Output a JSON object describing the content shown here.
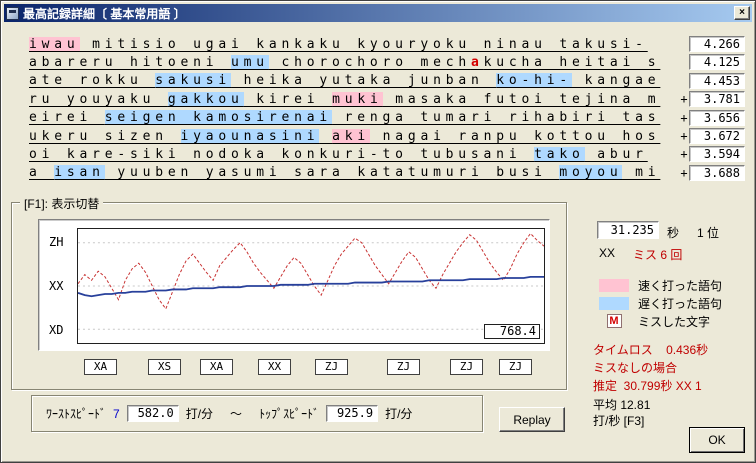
{
  "colors": {
    "fast": "#FFC3D2",
    "slow": "#AFD9FF",
    "miss": "#D40000",
    "red": "#C00000",
    "blue": "#0000CC",
    "title1": "#0A246A",
    "title2": "#A6CAF0"
  },
  "window": {
    "title": "最高記録詳細〔 基本常用語 〕",
    "close_glyph": "×"
  },
  "lines": [
    {
      "plus": false,
      "value": "4.266",
      "segments": [
        {
          "t": "iwau",
          "h": "fast"
        },
        {
          "t": " mitisio ugai kankaku kyouryoku ninau takusi-",
          "h": "none"
        }
      ]
    },
    {
      "plus": false,
      "value": "4.125",
      "segments": [
        {
          "t": "abareru hitoeni ",
          "h": "none"
        },
        {
          "t": "umu",
          "h": "slow"
        },
        {
          "t": " chorochoro mech",
          "h": "none"
        },
        {
          "t": "a",
          "h": "miss"
        },
        {
          "t": "kucha heitai s",
          "h": "none"
        }
      ]
    },
    {
      "plus": false,
      "value": "4.453",
      "segments": [
        {
          "t": "ate rokku ",
          "h": "none"
        },
        {
          "t": "sakusi",
          "h": "slow"
        },
        {
          "t": " heika yutaka junban ",
          "h": "none"
        },
        {
          "t": "ko-hi-",
          "h": "slow"
        },
        {
          "t": " kangae",
          "h": "none"
        }
      ]
    },
    {
      "plus": true,
      "value": "3.781",
      "segments": [
        {
          "t": "ru youyaku ",
          "h": "none"
        },
        {
          "t": "gakkou",
          "h": "slow"
        },
        {
          "t": " kirei ",
          "h": "none"
        },
        {
          "t": "muki",
          "h": "fast"
        },
        {
          "t": " masaka futoi tejina m",
          "h": "none"
        }
      ]
    },
    {
      "plus": true,
      "value": "3.656",
      "segments": [
        {
          "t": "eirei ",
          "h": "none"
        },
        {
          "t": "seigen kamosirenai",
          "h": "slow"
        },
        {
          "t": " renga tumari rihabiri tas",
          "h": "none"
        }
      ]
    },
    {
      "plus": true,
      "value": "3.672",
      "segments": [
        {
          "t": "ukeru sizen ",
          "h": "none"
        },
        {
          "t": "iyaounasini",
          "h": "slow"
        },
        {
          "t": " ",
          "h": "none"
        },
        {
          "t": "aki",
          "h": "fast"
        },
        {
          "t": " nagai ranpu kottou hos",
          "h": "none"
        }
      ]
    },
    {
      "plus": true,
      "value": "3.594",
      "segments": [
        {
          "t": "oi kare-siki nodoka konkuri-to tubusani ",
          "h": "none"
        },
        {
          "t": "tako",
          "h": "slow"
        },
        {
          "t": " abur",
          "h": "none"
        }
      ]
    },
    {
      "plus": true,
      "value": "3.688",
      "segments": [
        {
          "t": "a ",
          "h": "none"
        },
        {
          "t": "isan",
          "h": "slow"
        },
        {
          "t": " yuuben yasumi sara katatumuri busi ",
          "h": "none"
        },
        {
          "t": "moyou",
          "h": "slow"
        },
        {
          "t": " mi",
          "h": "none"
        }
      ]
    }
  ],
  "chart": {
    "group_label": "[F1]: 表示切替",
    "markers": [
      "XA",
      "XS",
      "XA",
      "XX",
      "ZJ",
      "ZJ",
      "ZJ",
      "ZJ"
    ]
  },
  "chart_data": {
    "type": "line",
    "y_axis_labels": [
      "ZH",
      "XX",
      "XD"
    ],
    "current_value": "768.4",
    "series": [
      {
        "name": "instantaneous-speed",
        "color": "#C83232",
        "style": "dashed",
        "values": [
          52,
          60,
          55,
          63,
          58,
          48,
          38,
          55,
          65,
          70,
          62,
          50,
          38,
          30,
          45,
          60,
          72,
          78,
          70,
          62,
          55,
          68,
          75,
          82,
          88,
          80,
          70,
          62,
          55,
          48,
          58,
          68,
          75,
          70,
          60,
          50,
          42,
          55,
          68,
          78,
          85,
          92,
          88,
          78,
          68,
          60,
          52,
          62,
          72,
          80,
          75,
          65,
          55,
          48,
          60,
          70,
          80,
          88,
          95,
          90,
          80,
          70,
          62,
          55,
          65,
          78,
          88,
          96,
          90,
          85
        ]
      },
      {
        "name": "average-speed",
        "color": "#28409B",
        "style": "solid",
        "values": [
          44,
          42,
          41,
          42,
          43,
          43,
          44,
          44,
          45,
          45,
          45,
          46,
          46,
          46,
          47,
          47,
          47,
          48,
          48,
          48,
          48,
          49,
          49,
          49,
          49,
          50,
          50,
          50,
          50,
          50,
          51,
          51,
          51,
          51,
          51,
          52,
          52,
          52,
          52,
          52,
          52,
          53,
          53,
          53,
          53,
          53,
          54,
          54,
          54,
          54,
          54,
          54,
          55,
          55,
          55,
          55,
          55,
          55,
          56,
          56,
          56,
          56,
          56,
          57,
          57,
          57,
          57,
          58,
          58,
          58
        ]
      }
    ]
  },
  "stats": {
    "time": "31.235",
    "time_unit": "秒",
    "rank": "1 位",
    "mask": "XX",
    "miss": "ミス 6 回",
    "timeloss": "タイムロス    0.436秒",
    "no_miss": "ミスなしの場合",
    "estimate": "推定  30.799秒 XX 1",
    "average_line1": "平均 12.81",
    "average_line2": "打/秒 [F3]",
    "ok": "OK"
  },
  "legend": [
    {
      "type": "swatch",
      "color": "#FFC3D2",
      "label": "速く打った語句"
    },
    {
      "type": "swatch",
      "color": "#AFD9FF",
      "label": "遅く打った語句"
    },
    {
      "type": "glyph",
      "glyph": "M",
      "label": "ミスした文字"
    }
  ],
  "speed": {
    "worst_label": "ﾜｰｽﾄｽﾋﾟｰﾄﾞ",
    "worst_rank": "7",
    "worst_value": "582.0",
    "unit": "打/分",
    "tilde": "～",
    "top_label": "ﾄｯﾌﾟｽﾋﾟｰﾄﾞ",
    "top_value": "925.9",
    "replay": "Replay"
  }
}
